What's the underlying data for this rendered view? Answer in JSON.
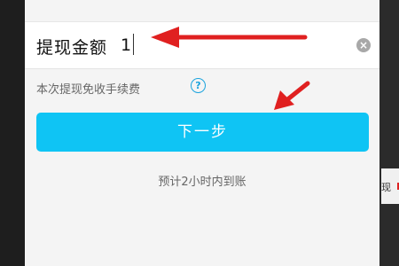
{
  "withdraw": {
    "amount_label": "提现金额",
    "amount_value": "1",
    "clear_icon": "×",
    "fee_note": "本次提现免收手续费",
    "help_icon": "?",
    "next_button": "下一步",
    "eta_note": "预计2小时内到账"
  },
  "background": {
    "side_text": "现"
  },
  "colors": {
    "accent_button": "#0fc4f4",
    "help_icon": "#1aa3dd",
    "annotation_arrow": "#e02020"
  }
}
